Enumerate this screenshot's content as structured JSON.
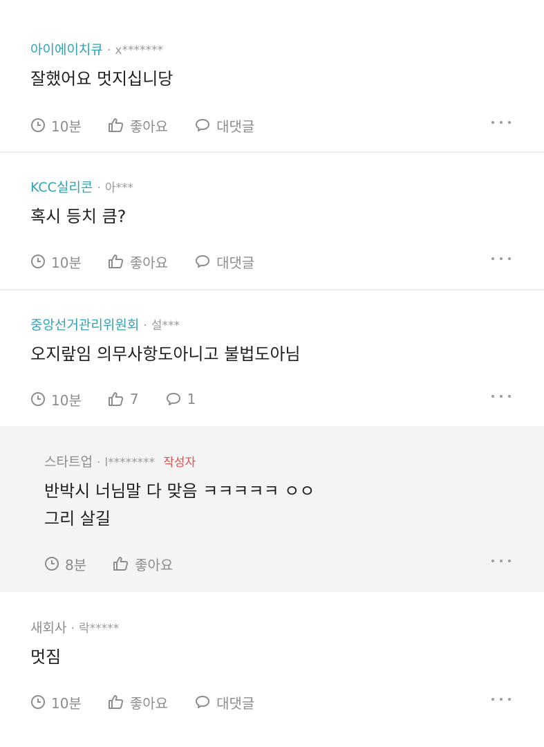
{
  "comments": [
    {
      "author": "아이에이치큐",
      "separator": "·",
      "masked_id": "x*******",
      "body_lines": [
        "잘했어요 멋지십니당"
      ],
      "time": "10분",
      "like_label": "좋아요",
      "reply_label": "대댓글"
    },
    {
      "author": "KCC실리콘",
      "separator": "·",
      "masked_id": "아***",
      "body_lines": [
        "혹시 등치 큼?"
      ],
      "time": "10분",
      "like_label": "좋아요",
      "reply_label": "대댓글"
    },
    {
      "author": "중앙선거관리위원회",
      "separator": "·",
      "masked_id": "설***",
      "body_lines": [
        "오지랖임 의무사항도아니고 불법도아님"
      ],
      "time": "10분",
      "like_label": "7",
      "reply_label": "1"
    },
    {
      "author": "스타트업",
      "separator": "·",
      "masked_id": "l********",
      "badge": "작성자",
      "body_lines": [
        "반박시 너님말 다 맞음 ㅋㅋㅋㅋㅋ ㅇㅇ",
        "그리 살길"
      ],
      "time": "8분",
      "like_label": "좋아요"
    },
    {
      "author": "새회사",
      "separator": "·",
      "masked_id": "락*****",
      "body_lines": [
        "멋짐"
      ],
      "time": "10분",
      "like_label": "좋아요",
      "reply_label": "대댓글"
    }
  ],
  "icons": {
    "clock": "clock-icon",
    "like": "thumbs-up-icon",
    "reply": "speech-bubble-icon",
    "more": "more-dots-icon"
  },
  "colors": {
    "author_link": "#2fa3b5",
    "author_badge": "#d9534f",
    "reply_background": "#f4f4f4"
  }
}
